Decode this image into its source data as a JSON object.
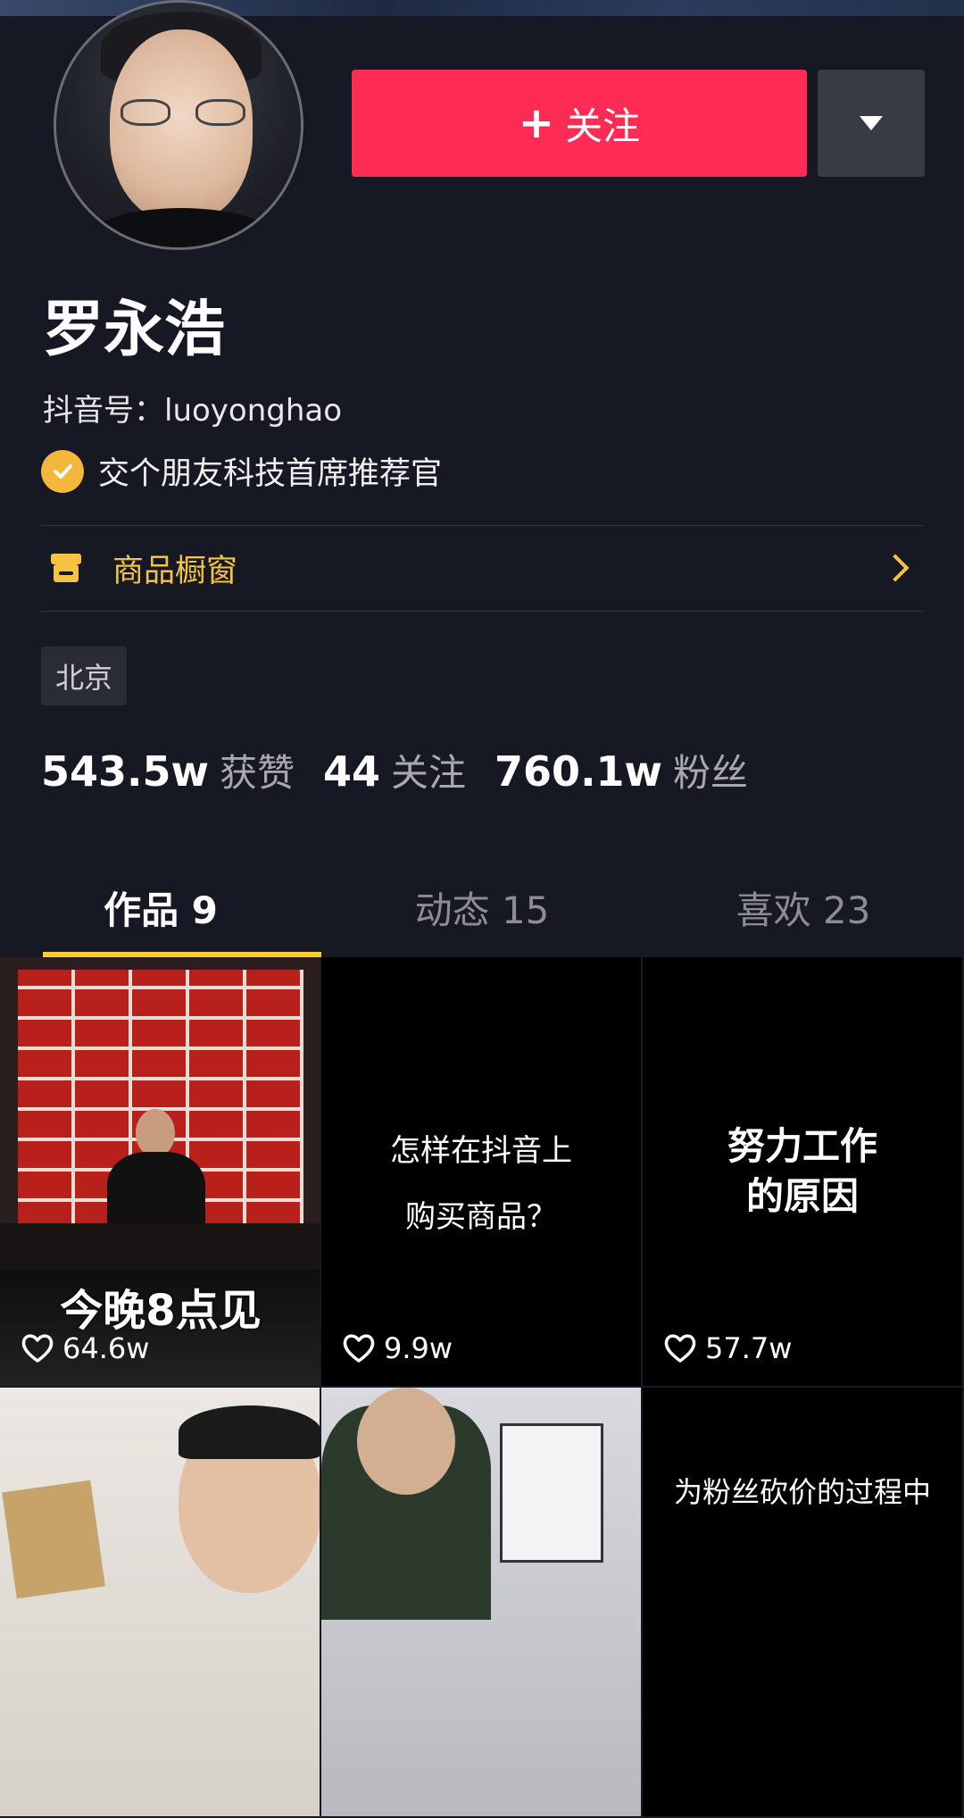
{
  "profile": {
    "name": "罗永浩",
    "douyin_id": "抖音号：luoyonghao",
    "verification": "交个朋友科技首席推荐官",
    "location": "北京"
  },
  "actions": {
    "follow_label": "关注",
    "follow_plus": "+"
  },
  "shop": {
    "label": "商品橱窗"
  },
  "stats": [
    {
      "value": "543.5w",
      "label": "获赞"
    },
    {
      "value": "44",
      "label": "关注"
    },
    {
      "value": "760.1w",
      "label": "粉丝"
    }
  ],
  "tabs": [
    {
      "label": "作品 9",
      "active": true
    },
    {
      "label": "动态 15",
      "active": false
    },
    {
      "label": "喜欢 23",
      "active": false
    }
  ],
  "videos": [
    {
      "overlay": "今晚8点见",
      "likes": "64.6w"
    },
    {
      "title_line1": "怎样在抖音上",
      "title_line2": "购买商品？",
      "likes": "9.9w"
    },
    {
      "title_line1": "努力工作",
      "title_line2": "的原因",
      "likes": "57.7w"
    },
    {
      "likes": ""
    },
    {
      "likes": ""
    },
    {
      "title_line1": "为粉丝砍价的过程中"
    }
  ],
  "colors": {
    "background": "#161823",
    "follow_button": "#fe2c55",
    "accent_yellow": "#facc2e",
    "shop_text": "#f5c342",
    "verify_badge": "#f5b73b"
  }
}
